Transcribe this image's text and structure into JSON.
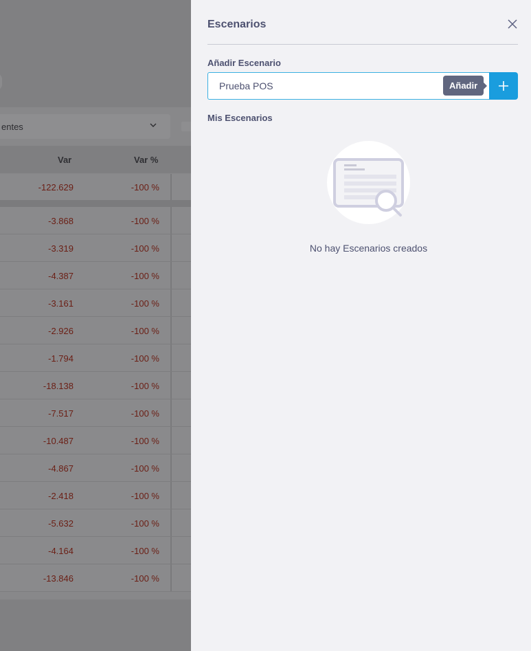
{
  "background": {
    "filter_label": "entes",
    "columns": {
      "var": "Var",
      "var_pct": "Var %"
    },
    "total_row": {
      "var": "-122.629",
      "var_pct": "-100 %"
    },
    "rows": [
      {
        "var": "-3.868",
        "var_pct": "-100 %"
      },
      {
        "var": "-3.319",
        "var_pct": "-100 %"
      },
      {
        "var": "-4.387",
        "var_pct": "-100 %"
      },
      {
        "var": "-3.161",
        "var_pct": "-100 %"
      },
      {
        "var": "-2.926",
        "var_pct": "-100 %"
      },
      {
        "var": "-1.794",
        "var_pct": "-100 %"
      },
      {
        "var": "-18.138",
        "var_pct": "-100 %"
      },
      {
        "var": "-7.517",
        "var_pct": "-100 %"
      },
      {
        "var": "-10.487",
        "var_pct": "-100 %"
      },
      {
        "var": "-4.867",
        "var_pct": "-100 %"
      },
      {
        "var": "-2.418",
        "var_pct": "-100 %"
      },
      {
        "var": "-5.632",
        "var_pct": "-100 %"
      },
      {
        "var": "-4.164",
        "var_pct": "-100 %"
      },
      {
        "var": "-13.846",
        "var_pct": "-100 %"
      }
    ]
  },
  "panel": {
    "title": "Escenarios",
    "close_icon": "close-icon",
    "add_section_label": "Añadir Escenario",
    "input_value": "Prueba POS",
    "tooltip": "Añadir",
    "add_icon": "plus-icon",
    "my_section_label": "Mis Escenarios",
    "empty_icon": "document-search-icon",
    "empty_text": "No hay Escenarios creados",
    "accent_color": "#1a9dde"
  }
}
